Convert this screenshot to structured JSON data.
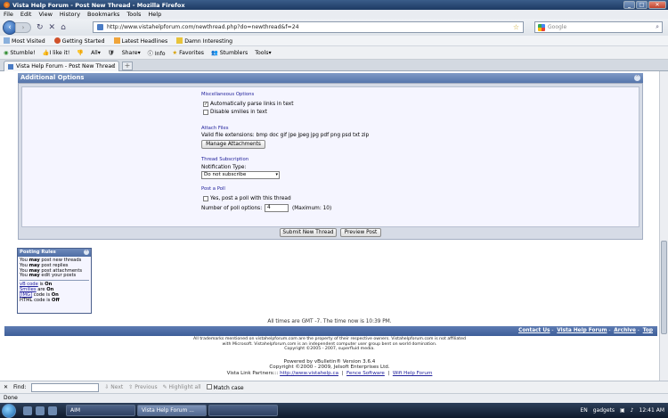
{
  "window": {
    "title": "Vista Help Forum - Post New Thread - Mozilla Firefox"
  },
  "menu": [
    "File",
    "Edit",
    "View",
    "History",
    "Bookmarks",
    "Tools",
    "Help"
  ],
  "address": {
    "url": "http://www.vistahelpforum.com/newthread.php?do=newthread&f=24",
    "search_placeholder": "Google"
  },
  "bookmarks": [
    "Most Visited",
    "Getting Started",
    "Latest Headlines",
    "Damn Interesting"
  ],
  "toolbar2": [
    "Stumble!",
    "I like it!",
    "All",
    "Share",
    "Info",
    "Favorites",
    "Stumblers",
    "Tools"
  ],
  "tab": {
    "label": "Vista Help Forum - Post New Thread"
  },
  "additional_options": {
    "header": "Additional Options",
    "misc_label": "Miscellaneous Options",
    "parse_links": "Automatically parse links in text",
    "disable_smilies": "Disable smilies in text",
    "attach_label": "Attach Files",
    "valid_ext": "Valid file extensions: bmp doc gif jpe jpeg jpg pdf png psd txt zip",
    "manage_attachments": "Manage Attachments",
    "subscription_label": "Thread Subscription",
    "notification_type": "Notification Type:",
    "notification_value": "Do not subscribe",
    "poll_label": "Post a Poll",
    "poll_checkbox": "Yes, post a poll with this thread",
    "poll_options_label": "Number of poll options:",
    "poll_options_value": "4",
    "poll_max": "(Maximum: 10)"
  },
  "buttons": {
    "submit": "Submit New Thread",
    "preview": "Preview Post"
  },
  "posting_rules": {
    "header": "Posting Rules",
    "lines": [
      {
        "pre": "You ",
        "bold": "may",
        "post": " post new threads"
      },
      {
        "pre": "You ",
        "bold": "may",
        "post": " post replies"
      },
      {
        "pre": "You ",
        "bold": "may",
        "post": " post attachments"
      },
      {
        "pre": "You ",
        "bold": "may",
        "post": " edit your posts"
      }
    ],
    "codes": [
      {
        "link": "vB code",
        "mid": " is ",
        "status": "On"
      },
      {
        "link": "Smilies",
        "mid": " are ",
        "status": "On"
      },
      {
        "link": "[IMG]",
        "mid": " code is ",
        "status": "On"
      },
      {
        "link": "",
        "mid": "HTML code is ",
        "status": "Off"
      }
    ]
  },
  "time_notice": "All times are GMT -7. The time now is 10:39 PM.",
  "footer_links": [
    "Contact Us",
    "Vista Help Forum",
    "Archive",
    "Top"
  ],
  "disclaimer": [
    "All trademarks mentioned on vistahelpforum.com are the property of their respective owners. Vistahelpforum.com is not affiliated",
    "with Microsoft. Vistahelpforum.com is an independent computer user group bent on world domination.",
    "Copyright ©2005 - 2007, superfluid media."
  ],
  "powered": [
    "Powered by vBulletin® Version 3.6.4",
    "Copyright ©2000 - 2009, Jelsoft Enterprises Ltd."
  ],
  "partners": {
    "label": "Vista Link Partners:::",
    "links": [
      "http://www.vistahelp.ca",
      "Fence Software",
      "Wifi Help Forum"
    ]
  },
  "findbar": {
    "label": "Find:",
    "next": "Next",
    "previous": "Previous",
    "highlight": "Highlight all",
    "match_case": "Match case"
  },
  "status": "Done",
  "taskbar": {
    "buttons": [
      "AIM",
      "Vista Help Forum ...",
      ""
    ],
    "tray_lang": "EN",
    "tray_item": "gadgets",
    "clock": "12:41 AM"
  }
}
